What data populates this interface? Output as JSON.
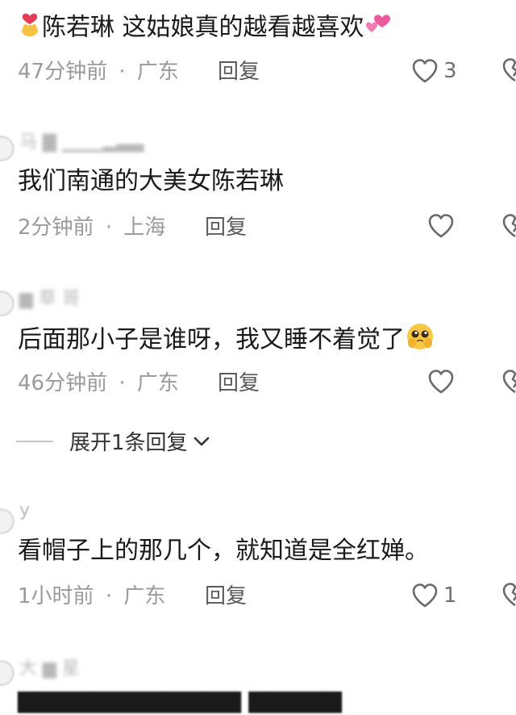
{
  "comments": [
    {
      "text_parts": [
        "陈若琳 这姑娘真的越看越喜欢"
      ],
      "leading_emoji": "heart-hands-emoji",
      "trailing_emoji": "two-hearts-emoji",
      "time": "47分钟前",
      "location": "广东",
      "reply_label": "回复",
      "likes": "3"
    },
    {
      "username": "马 ▇ ▁▁▁▂▃▃",
      "text": "我们南通的大美女陈若琳",
      "time": "2分钟前",
      "location": "上海",
      "reply_label": "回复",
      "likes": ""
    },
    {
      "username": "▆ 草 哥",
      "text": "后面那小子是谁呀，我又睡不着觉了",
      "trailing_emoji": "pleading-face-emoji",
      "time": "46分钟前",
      "location": "广东",
      "reply_label": "回复",
      "likes": "",
      "expand_label": "展开1条回复"
    },
    {
      "username": "y",
      "text": "看帽子上的那几个，就知道是全红婵。",
      "time": "1小时前",
      "location": "广东",
      "reply_label": "回复",
      "likes": "1"
    },
    {
      "username": "大 ▆ 星",
      "text_partial": "▆▆▆▆▆▆▆▆▆▆▆▆ ▆▆▆▆▆"
    }
  ],
  "separator": "·",
  "colors": {
    "text": "#1a1a1a",
    "meta": "#9a9a9a",
    "reply": "#5a5a5a",
    "icon": "#6a6a6a"
  }
}
